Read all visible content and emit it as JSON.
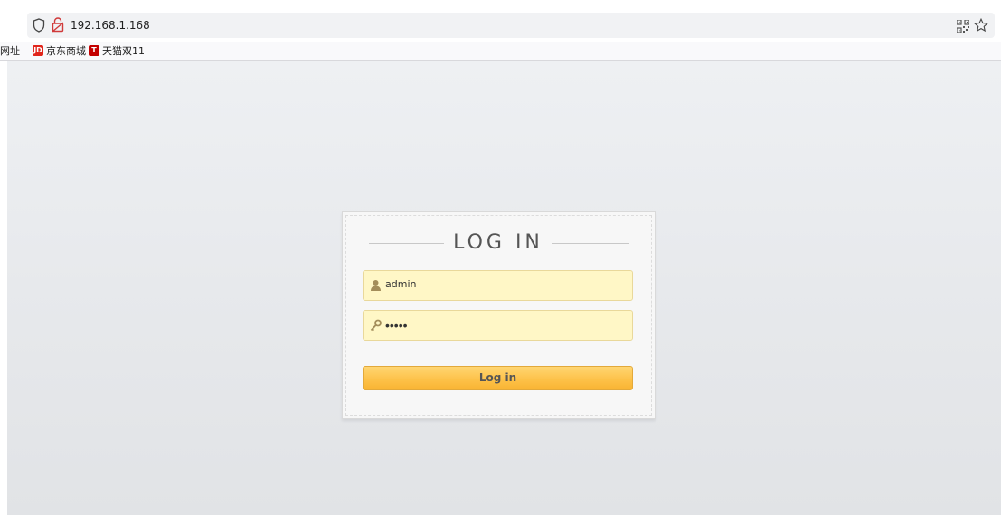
{
  "browser": {
    "url": "192.168.1.168",
    "bookmarks": [
      {
        "label": "网址",
        "icon": "partial-bookmark"
      },
      {
        "label": "京东商城",
        "favicon_text": "JD",
        "color": "#e1251b"
      },
      {
        "label": "天猫双11",
        "favicon_text": "T",
        "color": "#c40000"
      }
    ]
  },
  "login": {
    "title": "LOG IN",
    "username_value": "admin",
    "password_mask": "•••••",
    "submit_label": "Log in",
    "icons": {
      "username": "user-icon",
      "password": "key-icon"
    }
  },
  "colors": {
    "field_bg": "#fff7c6",
    "button": "#fdc24a",
    "page_bg": "#e8eaed"
  }
}
